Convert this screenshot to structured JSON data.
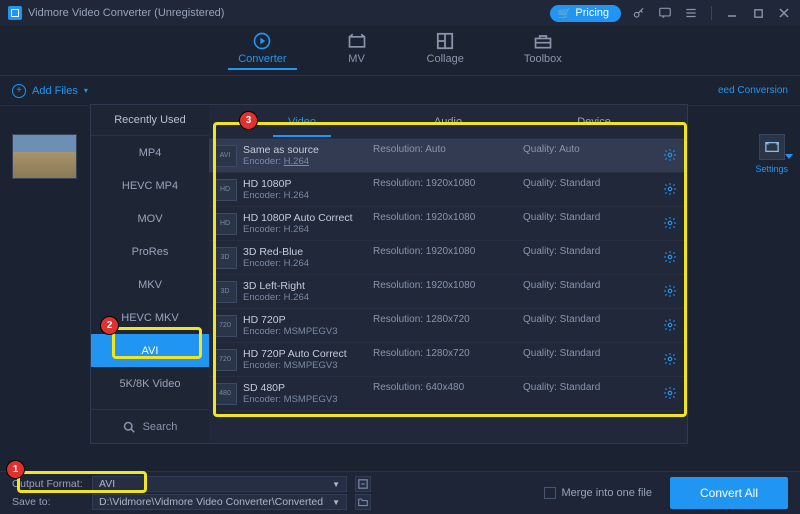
{
  "window": {
    "title": "Vidmore Video Converter (Unregistered)",
    "pricing": "Pricing"
  },
  "top_tabs": [
    {
      "label": "Converter",
      "active": true
    },
    {
      "label": "MV",
      "active": false
    },
    {
      "label": "Collage",
      "active": false
    },
    {
      "label": "Toolbox",
      "active": false
    }
  ],
  "toolbar": {
    "add_files": "Add Files",
    "speed": "eed Conversion"
  },
  "side_panel": {
    "settings_label": "Settings"
  },
  "popup": {
    "recently_used": "Recently Used",
    "search": "Search",
    "format_items": [
      {
        "label": "MP4",
        "selected": false
      },
      {
        "label": "HEVC MP4",
        "selected": false
      },
      {
        "label": "MOV",
        "selected": false
      },
      {
        "label": "ProRes",
        "selected": false
      },
      {
        "label": "MKV",
        "selected": false
      },
      {
        "label": "HEVC MKV",
        "selected": false
      },
      {
        "label": "AVI",
        "selected": true
      },
      {
        "label": "5K/8K Video",
        "selected": false
      }
    ],
    "cat_tabs": [
      {
        "label": "Video",
        "active": true
      },
      {
        "label": "Audio",
        "active": false
      },
      {
        "label": "Device",
        "active": false
      }
    ],
    "presets": [
      {
        "name": "Same as source",
        "enc_label": "Encoder:",
        "enc": "H.264",
        "enc_link": true,
        "res_label": "Resolution:",
        "res": "Auto",
        "q_label": "Quality:",
        "q": "Auto",
        "sel": true,
        "tag": "AVI"
      },
      {
        "name": "HD 1080P",
        "enc_label": "Encoder:",
        "enc": "H.264",
        "res_label": "Resolution:",
        "res": "1920x1080",
        "q_label": "Quality:",
        "q": "Standard",
        "tag": "HD"
      },
      {
        "name": "HD 1080P Auto Correct",
        "enc_label": "Encoder:",
        "enc": "H.264",
        "res_label": "Resolution:",
        "res": "1920x1080",
        "q_label": "Quality:",
        "q": "Standard",
        "tag": "HD"
      },
      {
        "name": "3D Red-Blue",
        "enc_label": "Encoder:",
        "enc": "H.264",
        "res_label": "Resolution:",
        "res": "1920x1080",
        "q_label": "Quality:",
        "q": "Standard",
        "tag": "3D"
      },
      {
        "name": "3D Left-Right",
        "enc_label": "Encoder:",
        "enc": "H.264",
        "res_label": "Resolution:",
        "res": "1920x1080",
        "q_label": "Quality:",
        "q": "Standard",
        "tag": "3D"
      },
      {
        "name": "HD 720P",
        "enc_label": "Encoder:",
        "enc": "MSMPEGV3",
        "res_label": "Resolution:",
        "res": "1280x720",
        "q_label": "Quality:",
        "q": "Standard",
        "tag": "720"
      },
      {
        "name": "HD 720P Auto Correct",
        "enc_label": "Encoder:",
        "enc": "MSMPEGV3",
        "res_label": "Resolution:",
        "res": "1280x720",
        "q_label": "Quality:",
        "q": "Standard",
        "tag": "720"
      },
      {
        "name": "SD 480P",
        "enc_label": "Encoder:",
        "enc": "MSMPEGV3",
        "res_label": "Resolution:",
        "res": "640x480",
        "q_label": "Quality:",
        "q": "Standard",
        "tag": "480"
      }
    ]
  },
  "footer": {
    "output_format_label": "Output Format:",
    "output_format_value": "AVI",
    "save_to_label": "Save to:",
    "save_to_value": "D:\\Vidmore\\Vidmore Video Converter\\Converted",
    "merge_label": "Merge into one file",
    "convert_label": "Convert All"
  },
  "callouts": {
    "c1": "1",
    "c2": "2",
    "c3": "3"
  }
}
